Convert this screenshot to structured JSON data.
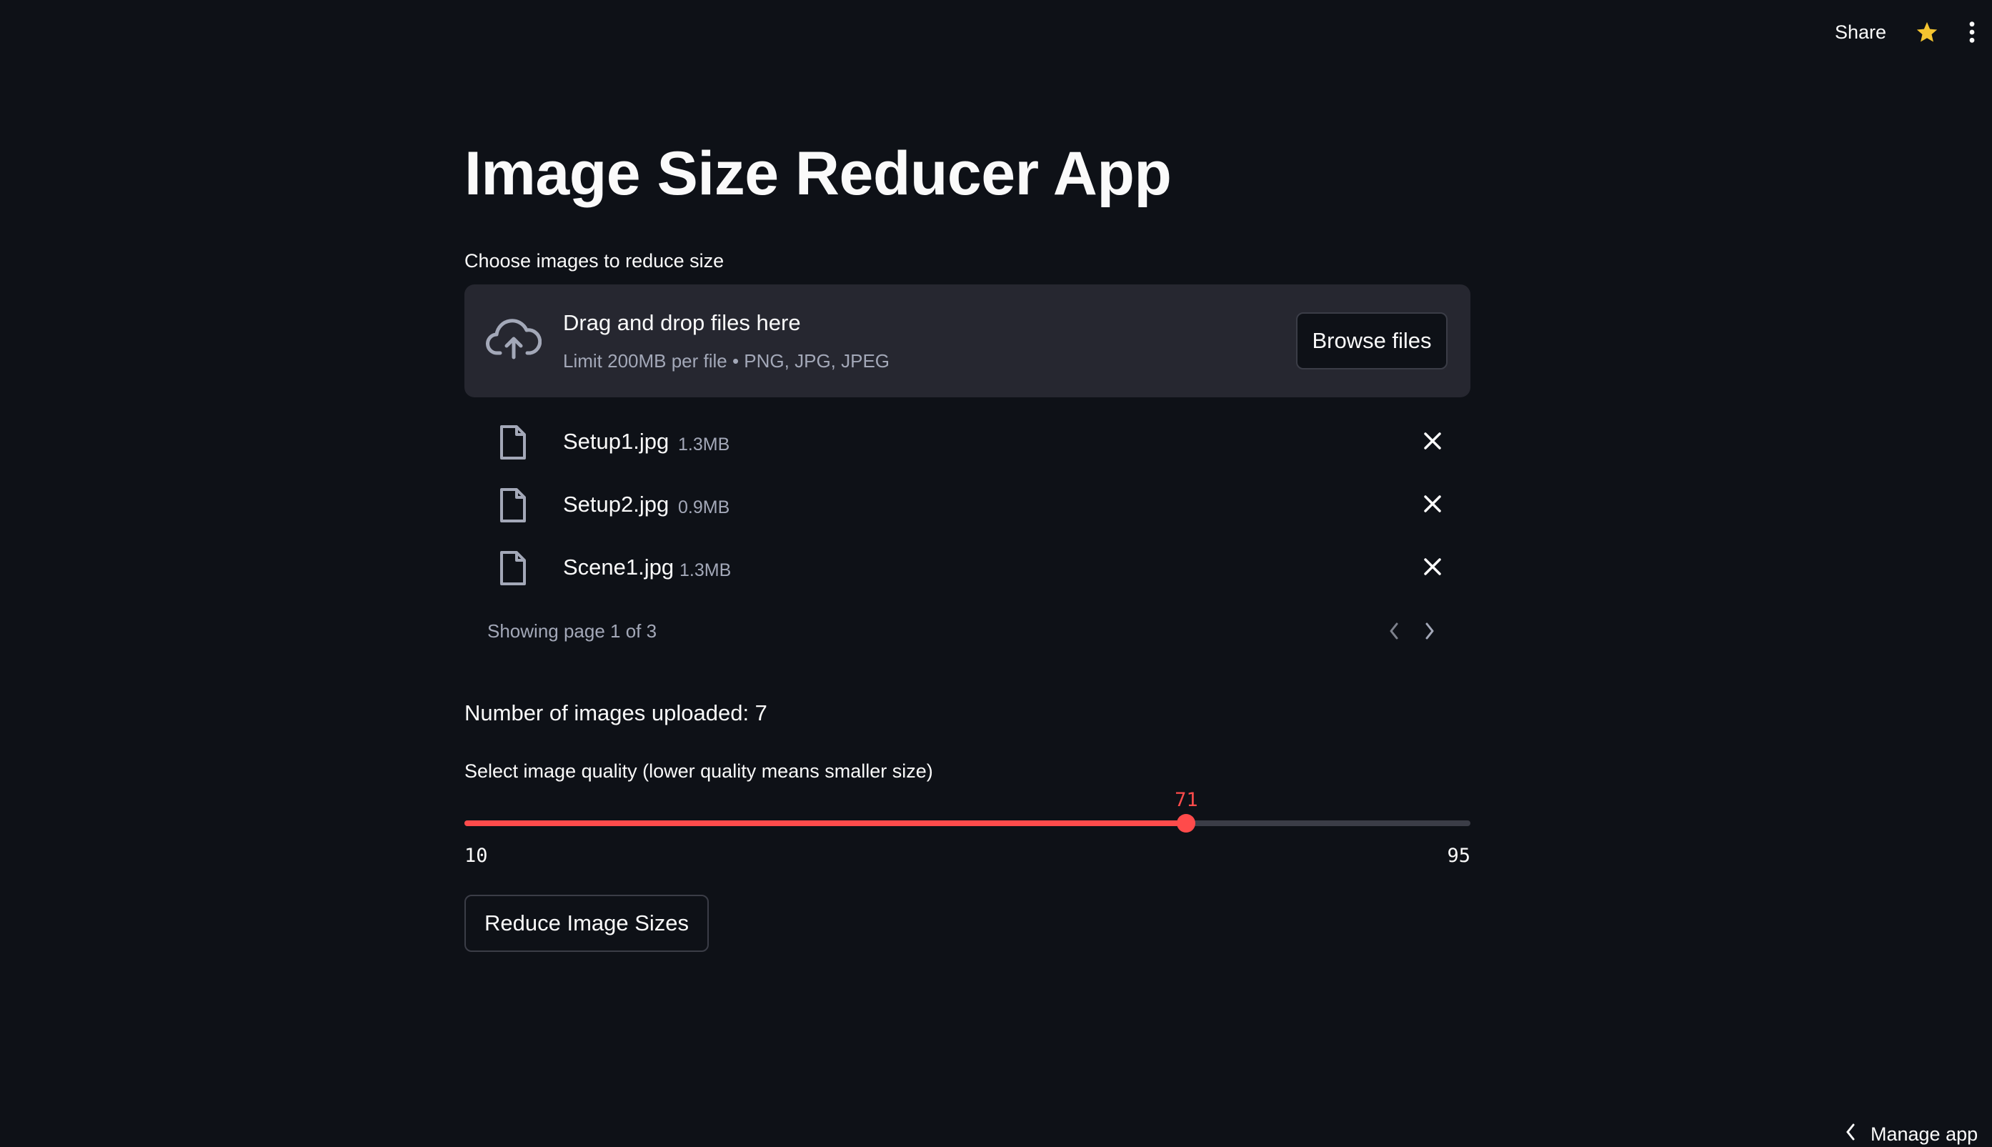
{
  "header": {
    "share_label": "Share",
    "star_icon": "star-icon",
    "menu_icon": "more-vertical-icon"
  },
  "page": {
    "title": "Image Size Reducer App"
  },
  "uploader": {
    "label": "Choose images to reduce size",
    "drop_title": "Drag and drop files here",
    "drop_subtitle": "Limit 200MB per file • PNG, JPG, JPEG",
    "browse_label": "Browse files",
    "files": [
      {
        "name": "Setup1.jpg",
        "size": "1.3MB"
      },
      {
        "name": "Setup2.jpg",
        "size": "0.9MB"
      },
      {
        "name": "Scene1.jpg",
        "size": "1.3MB"
      }
    ],
    "pagination_text": "Showing page 1 of 3"
  },
  "count_text": "Number of images uploaded: 7",
  "quality_slider": {
    "label": "Select image quality (lower quality means smaller size)",
    "value": "71",
    "min": "10",
    "max": "95"
  },
  "action_button": "Reduce Image Sizes",
  "footer": {
    "manage_label": "Manage app"
  },
  "colors": {
    "background": "#0e1117",
    "accent": "#ff4b4b",
    "panel": "#262730",
    "star": "#f4c430"
  }
}
